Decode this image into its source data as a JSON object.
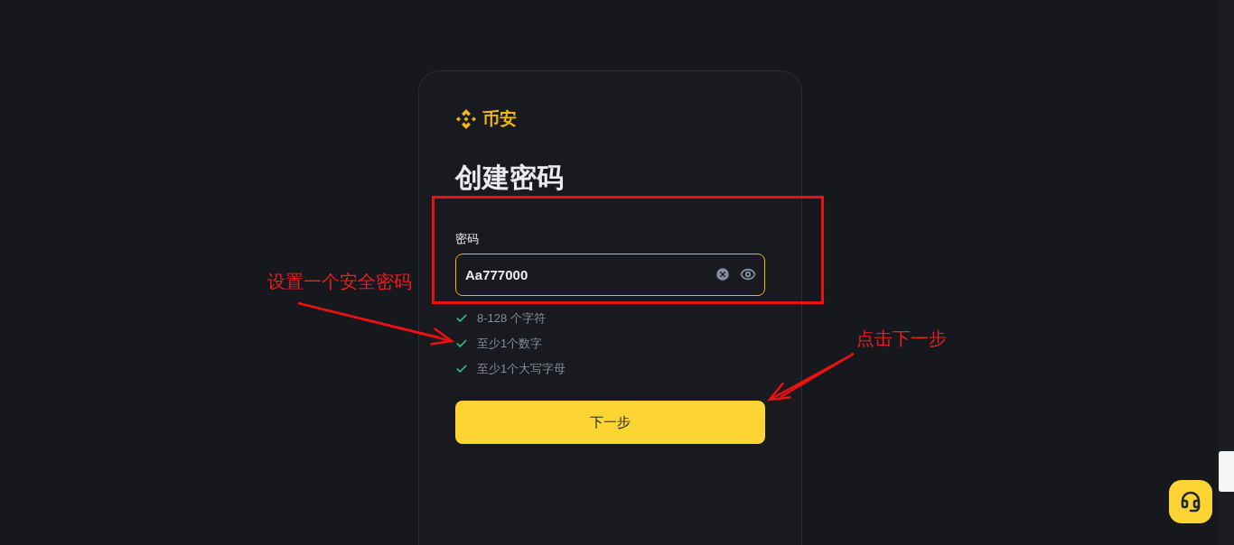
{
  "brand": {
    "name": "币安"
  },
  "title": "创建密码",
  "password_field": {
    "label": "密码",
    "value": "Aa777000"
  },
  "requirements": [
    {
      "text": "8-128 个字符",
      "met": true
    },
    {
      "text": "至少1个数字",
      "met": true
    },
    {
      "text": "至少1个大写字母",
      "met": true
    }
  ],
  "next_button": "下一步",
  "annotations": [
    {
      "text": "设置一个安全密码"
    },
    {
      "text": "点击下一步"
    }
  ]
}
